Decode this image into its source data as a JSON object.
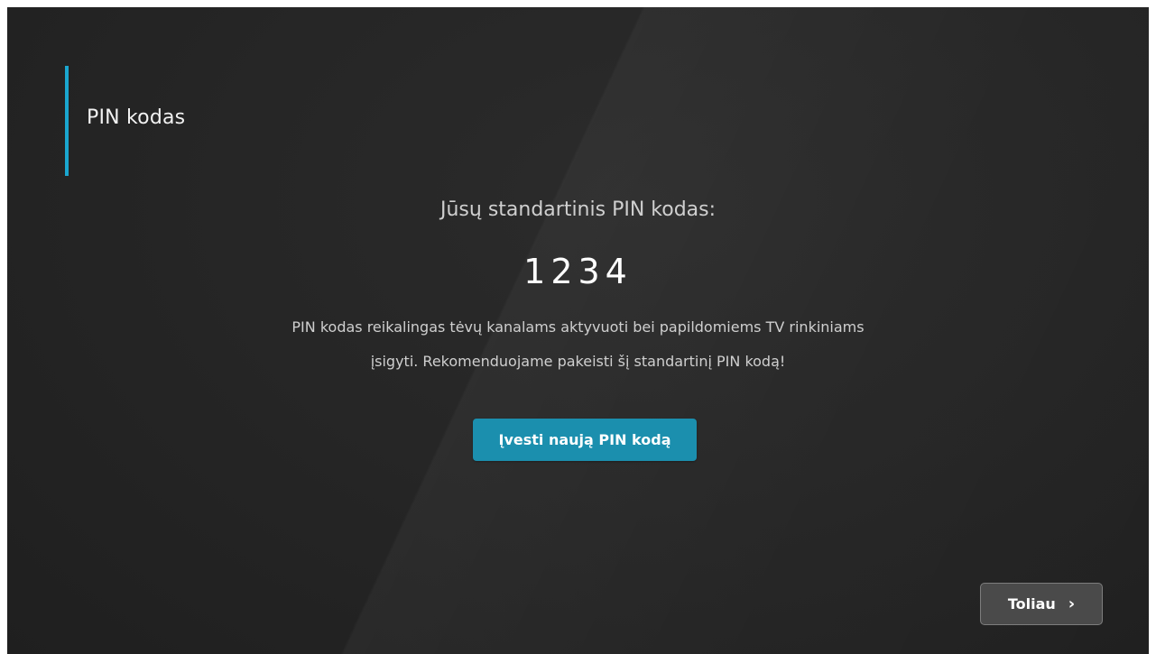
{
  "header": {
    "title": "PIN kodas"
  },
  "main": {
    "subtitle": "Jūsų standartinis PIN kodas:",
    "pin": "1234",
    "description_line1": "PIN kodas reikalingas tėvų kanalams aktyvuoti bei papildomiems TV rinkiniams",
    "description_line2": "įsigyti.  Rekomenduojame pakeisti šį standartinį PIN kodą!",
    "change_pin_button": "Įvesti naują PIN kodą"
  },
  "footer": {
    "next_button": "Toliau",
    "next_icon": "chevron-right-icon"
  },
  "colors": {
    "accent": "#1aa6cf",
    "button_primary": "#1b8fae",
    "background": "#262626"
  }
}
